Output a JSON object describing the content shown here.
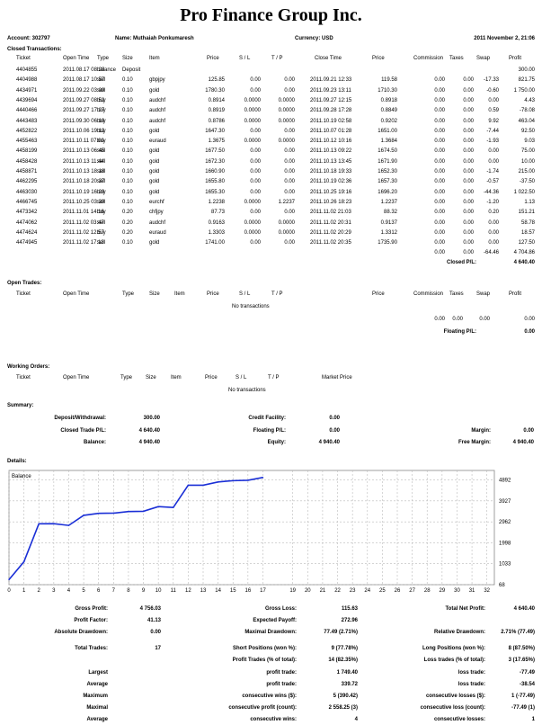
{
  "title": "Pro Finance Group Inc.",
  "account": {
    "account_label": "Account: 302797",
    "name_label": "Name: Muthaiah Ponkumaresh",
    "currency_label": "Currency: USD",
    "date": "2011 November 2, 21:06"
  },
  "closed": {
    "section": "Closed Transactions:",
    "headers": [
      "Ticket",
      "Open Time",
      "Type",
      "Size",
      "Item",
      "Price",
      "S / L",
      "T / P",
      "Close Time",
      "Price",
      "Commission",
      "Taxes",
      "Swap",
      "Profit"
    ],
    "rows": [
      [
        "4404855",
        "2011.08.17 08:28",
        "balance",
        "Deposit",
        "",
        "",
        "",
        "",
        "",
        "",
        "",
        "",
        "",
        "300.00"
      ],
      [
        "4404988",
        "2011.08.17 10:57",
        "sell",
        "0.10",
        "gbpjpy",
        "125.85",
        "0.00",
        "0.00",
        "2011.09.21 12:33",
        "119.58",
        "0.00",
        "0.00",
        "-17.33",
        "821.75"
      ],
      [
        "4434971",
        "2011.09.22 03:09",
        "sell",
        "0.10",
        "gold",
        "1780.30",
        "0.00",
        "0.00",
        "2011.09.23 13:11",
        "1710.30",
        "0.00",
        "0.00",
        "-0.60",
        "1 750.00"
      ],
      [
        "4439694",
        "2011.09.27 08:52",
        "buy",
        "0.10",
        "audchf",
        "0.8914",
        "0.0000",
        "0.0000",
        "2011.09.27 12:15",
        "0.8918",
        "0.00",
        "0.00",
        "0.00",
        "4.43"
      ],
      [
        "4440466",
        "2011.09.27 17:27",
        "buy",
        "0.10",
        "audchf",
        "0.8919",
        "0.0000",
        "0.0000",
        "2011.09.28 17:28",
        "0.8849",
        "0.00",
        "0.00",
        "0.59",
        "-78.08"
      ],
      [
        "4443483",
        "2011.09.30 06:10",
        "buy",
        "0.10",
        "audchf",
        "0.8786",
        "0.0000",
        "0.0000",
        "2011.10.19 02:58",
        "0.9202",
        "0.00",
        "0.00",
        "9.92",
        "463.04"
      ],
      [
        "4452822",
        "2011.10.06 19:12",
        "buy",
        "0.10",
        "gold",
        "1647.30",
        "0.00",
        "0.00",
        "2011.10.07 01:28",
        "1651.00",
        "0.00",
        "0.00",
        "-7.44",
        "92.50"
      ],
      [
        "4455463",
        "2011.10.11 07:00",
        "buy",
        "0.10",
        "euraud",
        "1.3675",
        "0.0000",
        "0.0000",
        "2011.10.12 10:16",
        "1.3684",
        "0.00",
        "0.00",
        "-1.93",
        "9.03"
      ],
      [
        "4458199",
        "2011.10.13 06:45",
        "sell",
        "0.10",
        "gold",
        "1677.50",
        "0.00",
        "0.00",
        "2011.10.13 09:22",
        "1674.50",
        "0.00",
        "0.00",
        "0.00",
        "75.00"
      ],
      [
        "4458428",
        "2011.10.13 11:44",
        "sell",
        "0.10",
        "gold",
        "1672.30",
        "0.00",
        "0.00",
        "2011.10.13 13:45",
        "1671.90",
        "0.00",
        "0.00",
        "0.00",
        "10.00"
      ],
      [
        "4458871",
        "2011.10.13 18:18",
        "sell",
        "0.10",
        "gold",
        "1660.90",
        "0.00",
        "0.00",
        "2011.10.18 19:33",
        "1652.30",
        "0.00",
        "0.00",
        "-1.74",
        "215.00"
      ],
      [
        "4462295",
        "2011.10.18 20:37",
        "sell",
        "0.10",
        "gold",
        "1655.80",
        "0.00",
        "0.00",
        "2011.10.19 02:36",
        "1657.30",
        "0.00",
        "0.00",
        "-0.57",
        "-37.50"
      ],
      [
        "4463030",
        "2011.10.19 16:20",
        "buy",
        "0.10",
        "gold",
        "1655.30",
        "0.00",
        "0.00",
        "2011.10.25 19:16",
        "1696.20",
        "0.00",
        "0.00",
        "-44.36",
        "1 022.50"
      ],
      [
        "4466745",
        "2011.10.25 03:39",
        "sell",
        "0.10",
        "eurchf",
        "1.2238",
        "0.0000",
        "1.2237",
        "2011.10.26 18:23",
        "1.2237",
        "0.00",
        "0.00",
        "-1.20",
        "1.13"
      ],
      [
        "4473342",
        "2011.11.01 14:16",
        "buy",
        "0.20",
        "chfjpy",
        "87.73",
        "0.00",
        "0.00",
        "2011.11.02 21:03",
        "88.32",
        "0.00",
        "0.00",
        "0.20",
        "151.21"
      ],
      [
        "4474062",
        "2011.11.02 03:47",
        "sell",
        "0.20",
        "audchf",
        "0.9163",
        "0.0000",
        "0.0000",
        "2011.11.02 20:31",
        "0.9137",
        "0.00",
        "0.00",
        "0.00",
        "58.78"
      ],
      [
        "4474624",
        "2011.11.02 12:57",
        "buy",
        "0.20",
        "euraud",
        "1.3303",
        "0.0000",
        "0.0000",
        "2011.11.02 20:29",
        "1.3312",
        "0.00",
        "0.00",
        "0.00",
        "18.57"
      ],
      [
        "4474945",
        "2011.11.02 17:13",
        "sell",
        "0.10",
        "gold",
        "1741.00",
        "0.00",
        "0.00",
        "2011.11.02 20:35",
        "1735.90",
        "0.00",
        "0.00",
        "0.00",
        "127.50"
      ]
    ],
    "totals": [
      "0.00",
      "0.00",
      "-64.46",
      "4 704.86"
    ],
    "closed_pl_label": "Closed P/L:",
    "closed_pl_value": "4 640.40"
  },
  "open_trades": {
    "section": "Open Trades:",
    "headers": [
      "Ticket",
      "Open Time",
      "Type",
      "Size",
      "Item",
      "Price",
      "S / L",
      "T / P",
      "Price",
      "Commission",
      "Taxes",
      "Swap",
      "Profit"
    ],
    "empty": "No transactions",
    "totals": [
      "0.00",
      "0.00",
      "0.00",
      "0.00"
    ],
    "floating_label": "Floating P/L:",
    "floating_value": "0.00"
  },
  "working_orders": {
    "section": "Working Orders:",
    "headers": [
      "Ticket",
      "Open Time",
      "Type",
      "Size",
      "Item",
      "Price",
      "S / L",
      "T / P",
      "Market Price"
    ],
    "empty": "No transactions"
  },
  "summary": {
    "section": "Summary:",
    "deposit_label": "Deposit/Withdrawal:",
    "deposit_value": "300.00",
    "credit_label": "Credit Facility:",
    "credit_value": "0.00",
    "closed_label": "Closed Trade P/L:",
    "closed_value": "4 640.40",
    "floating_label": "Floating P/L:",
    "floating_value": "0.00",
    "margin_label": "Margin:",
    "margin_value": "0.00",
    "balance_label": "Balance:",
    "balance_value": "4 940.40",
    "equity_label": "Equity:",
    "equity_value": "4 940.40",
    "free_label": "Free Margin:",
    "free_value": "4 940.40"
  },
  "details_section": "Details:",
  "chart_data": {
    "type": "line",
    "title": "Balance",
    "x": [
      0,
      1,
      2,
      3,
      4,
      5,
      6,
      7,
      8,
      9,
      10,
      11,
      12,
      13,
      14,
      15,
      16,
      17
    ],
    "values": [
      300,
      1121.75,
      2871.75,
      2876.18,
      2798.1,
      3261.14,
      3353.64,
      3362.67,
      3437.67,
      3447.67,
      3662.67,
      3625.17,
      4647.67,
      4648.8,
      4800.01,
      4858.79,
      4877.36,
      5004.86
    ],
    "xticks": [
      0,
      1,
      2,
      3,
      4,
      5,
      6,
      7,
      8,
      9,
      10,
      11,
      12,
      13,
      14,
      15,
      16,
      17,
      19,
      20,
      21,
      22,
      23,
      24,
      25,
      26,
      27,
      28,
      29,
      30,
      31,
      32
    ],
    "yticks": [
      68,
      1033,
      1998,
      2962,
      3927,
      4892
    ],
    "ylim": [
      68,
      5330
    ],
    "xlim": [
      0,
      32.5
    ]
  },
  "stats": {
    "gross_profit_label": "Gross Profit:",
    "gross_profit": "4 756.03",
    "gross_loss_label": "Gross Loss:",
    "gross_loss": "115.63",
    "total_net_label": "Total Net Profit:",
    "total_net": "4 640.40",
    "profit_factor_label": "Profit Factor:",
    "profit_factor": "41.13",
    "expected_label": "Expected Payoff:",
    "expected": "272.96",
    "abs_dd_label": "Absolute Drawdown:",
    "abs_dd": "0.00",
    "max_dd_label": "Maximal Drawdown:",
    "max_dd": "77.49 (2.71%)",
    "rel_dd_label": "Relative Drawdown:",
    "rel_dd": "2.71% (77.49)",
    "total_trades_label": "Total Trades:",
    "total_trades": "17",
    "short_label": "Short Positions (won %):",
    "short": "9 (77.78%)",
    "long_label": "Long Positions (won %):",
    "long": "8 (87.50%)",
    "profit_trades_label": "Profit Trades (% of total):",
    "profit_trades": "14 (82.35%)",
    "loss_trades_label": "Loss trades (% of total):",
    "loss_trades": "3 (17.65%)",
    "largest_label": "Largest",
    "profit_trade_label": "profit trade:",
    "largest_profit": "1 749.40",
    "loss_trade_label": "loss trade:",
    "largest_loss": "-77.49",
    "average_label": "Average",
    "avg_profit": "339.72",
    "avg_loss": "-38.54",
    "maximum_label": "Maximum",
    "cons_wins_label": "consecutive wins ($):",
    "cons_wins": "5 (390.42)",
    "cons_losses_label": "consecutive losses ($):",
    "cons_losses": "1 (-77.49)",
    "maximal_label": "Maximal",
    "cons_profit_label": "consecutive profit (count):",
    "cons_profit": "2 558.25 (3)",
    "cons_loss_label": "consecutive loss (count):",
    "cons_loss": "-77.49 (1)",
    "average2_label": "Average",
    "avg_cons_wins_label": "consecutive wins:",
    "avg_cons_wins": "4",
    "avg_cons_losses_label": "consecutive losses:",
    "avg_cons_losses": "1"
  }
}
